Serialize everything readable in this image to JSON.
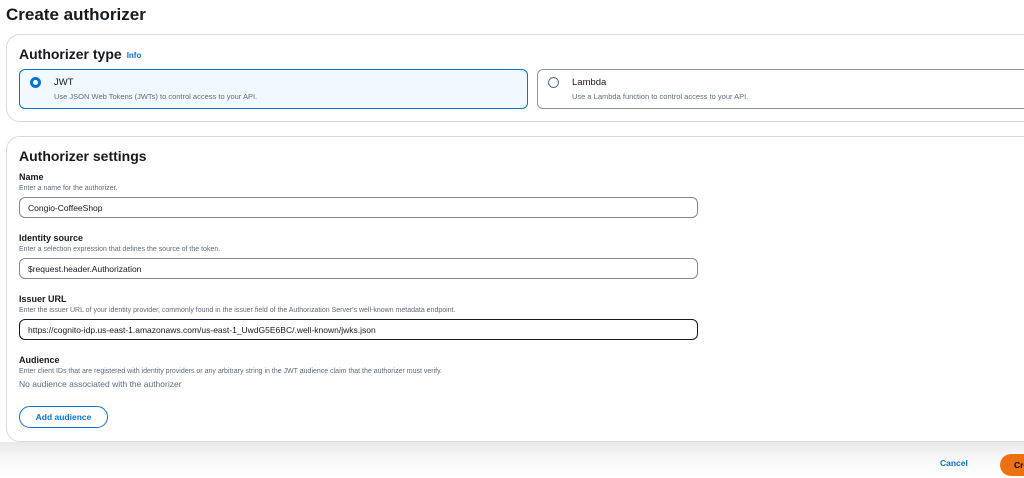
{
  "page": {
    "title": "Create authorizer"
  },
  "authorizer_type": {
    "heading": "Authorizer type",
    "info_link": "Info",
    "options": [
      {
        "label": "JWT",
        "description": "Use JSON Web Tokens (JWTs) to control access to your API.",
        "selected": true
      },
      {
        "label": "Lambda",
        "description": "Use a Lambda function to control access to your API.",
        "selected": false
      }
    ]
  },
  "settings": {
    "heading": "Authorizer settings",
    "name": {
      "label": "Name",
      "description": "Enter a name for the authorizer.",
      "value": "Congio-CoffeeShop"
    },
    "identity_source": {
      "label": "Identity source",
      "description": "Enter a selection expression that defines the source of the token.",
      "value": "$request.header.Authorization"
    },
    "issuer_url": {
      "label": "Issuer URL",
      "description": "Enter the issuer URL of your identity provider, commonly found in the issuer field of the Authorization Server's well-known metadata endpoint.",
      "value": "https://cognito-idp.us-east-1.amazonaws.com/us-east-1_UwdG5E6BC/.well-known/jwks.json"
    },
    "audience": {
      "label": "Audience",
      "description": "Enter client IDs that are registered with identity providers or any arbitrary string in the JWT audience claim that the authorizer must verify.",
      "empty_text": "No audience associated with the authorizer",
      "add_button": "Add audience"
    }
  },
  "footer": {
    "cancel_label": "Cancel",
    "create_label": "Create"
  },
  "colors": {
    "accent": "#0972d3",
    "primary_button": "#ec7211",
    "selected_tile_bg": "#f1f8ff"
  }
}
